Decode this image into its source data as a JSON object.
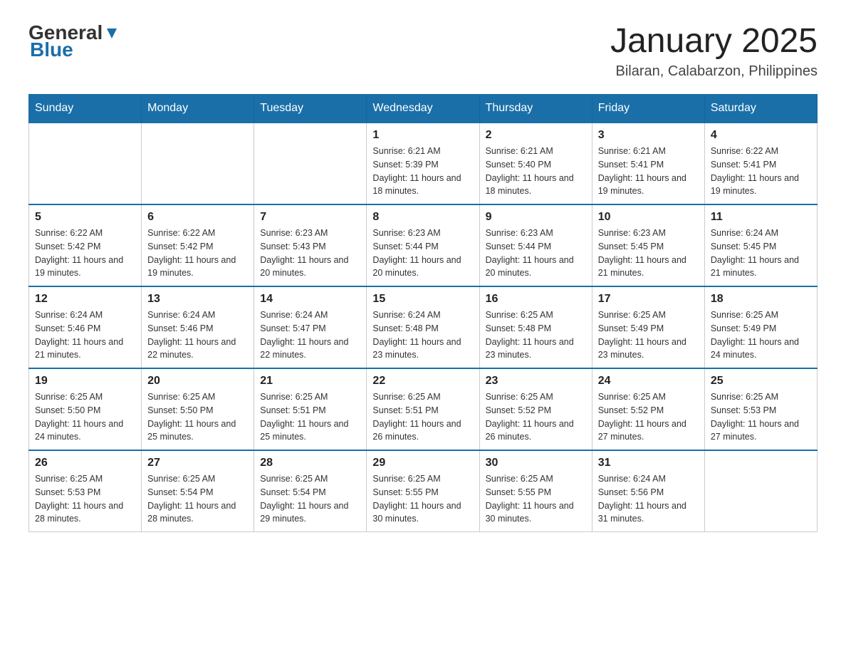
{
  "header": {
    "logo": {
      "general": "General",
      "blue": "Blue"
    },
    "title": "January 2025",
    "location": "Bilaran, Calabarzon, Philippines"
  },
  "days_of_week": [
    "Sunday",
    "Monday",
    "Tuesday",
    "Wednesday",
    "Thursday",
    "Friday",
    "Saturday"
  ],
  "weeks": [
    [
      {
        "day": "",
        "info": ""
      },
      {
        "day": "",
        "info": ""
      },
      {
        "day": "",
        "info": ""
      },
      {
        "day": "1",
        "info": "Sunrise: 6:21 AM\nSunset: 5:39 PM\nDaylight: 11 hours and 18 minutes."
      },
      {
        "day": "2",
        "info": "Sunrise: 6:21 AM\nSunset: 5:40 PM\nDaylight: 11 hours and 18 minutes."
      },
      {
        "day": "3",
        "info": "Sunrise: 6:21 AM\nSunset: 5:41 PM\nDaylight: 11 hours and 19 minutes."
      },
      {
        "day": "4",
        "info": "Sunrise: 6:22 AM\nSunset: 5:41 PM\nDaylight: 11 hours and 19 minutes."
      }
    ],
    [
      {
        "day": "5",
        "info": "Sunrise: 6:22 AM\nSunset: 5:42 PM\nDaylight: 11 hours and 19 minutes."
      },
      {
        "day": "6",
        "info": "Sunrise: 6:22 AM\nSunset: 5:42 PM\nDaylight: 11 hours and 19 minutes."
      },
      {
        "day": "7",
        "info": "Sunrise: 6:23 AM\nSunset: 5:43 PM\nDaylight: 11 hours and 20 minutes."
      },
      {
        "day": "8",
        "info": "Sunrise: 6:23 AM\nSunset: 5:44 PM\nDaylight: 11 hours and 20 minutes."
      },
      {
        "day": "9",
        "info": "Sunrise: 6:23 AM\nSunset: 5:44 PM\nDaylight: 11 hours and 20 minutes."
      },
      {
        "day": "10",
        "info": "Sunrise: 6:23 AM\nSunset: 5:45 PM\nDaylight: 11 hours and 21 minutes."
      },
      {
        "day": "11",
        "info": "Sunrise: 6:24 AM\nSunset: 5:45 PM\nDaylight: 11 hours and 21 minutes."
      }
    ],
    [
      {
        "day": "12",
        "info": "Sunrise: 6:24 AM\nSunset: 5:46 PM\nDaylight: 11 hours and 21 minutes."
      },
      {
        "day": "13",
        "info": "Sunrise: 6:24 AM\nSunset: 5:46 PM\nDaylight: 11 hours and 22 minutes."
      },
      {
        "day": "14",
        "info": "Sunrise: 6:24 AM\nSunset: 5:47 PM\nDaylight: 11 hours and 22 minutes."
      },
      {
        "day": "15",
        "info": "Sunrise: 6:24 AM\nSunset: 5:48 PM\nDaylight: 11 hours and 23 minutes."
      },
      {
        "day": "16",
        "info": "Sunrise: 6:25 AM\nSunset: 5:48 PM\nDaylight: 11 hours and 23 minutes."
      },
      {
        "day": "17",
        "info": "Sunrise: 6:25 AM\nSunset: 5:49 PM\nDaylight: 11 hours and 23 minutes."
      },
      {
        "day": "18",
        "info": "Sunrise: 6:25 AM\nSunset: 5:49 PM\nDaylight: 11 hours and 24 minutes."
      }
    ],
    [
      {
        "day": "19",
        "info": "Sunrise: 6:25 AM\nSunset: 5:50 PM\nDaylight: 11 hours and 24 minutes."
      },
      {
        "day": "20",
        "info": "Sunrise: 6:25 AM\nSunset: 5:50 PM\nDaylight: 11 hours and 25 minutes."
      },
      {
        "day": "21",
        "info": "Sunrise: 6:25 AM\nSunset: 5:51 PM\nDaylight: 11 hours and 25 minutes."
      },
      {
        "day": "22",
        "info": "Sunrise: 6:25 AM\nSunset: 5:51 PM\nDaylight: 11 hours and 26 minutes."
      },
      {
        "day": "23",
        "info": "Sunrise: 6:25 AM\nSunset: 5:52 PM\nDaylight: 11 hours and 26 minutes."
      },
      {
        "day": "24",
        "info": "Sunrise: 6:25 AM\nSunset: 5:52 PM\nDaylight: 11 hours and 27 minutes."
      },
      {
        "day": "25",
        "info": "Sunrise: 6:25 AM\nSunset: 5:53 PM\nDaylight: 11 hours and 27 minutes."
      }
    ],
    [
      {
        "day": "26",
        "info": "Sunrise: 6:25 AM\nSunset: 5:53 PM\nDaylight: 11 hours and 28 minutes."
      },
      {
        "day": "27",
        "info": "Sunrise: 6:25 AM\nSunset: 5:54 PM\nDaylight: 11 hours and 28 minutes."
      },
      {
        "day": "28",
        "info": "Sunrise: 6:25 AM\nSunset: 5:54 PM\nDaylight: 11 hours and 29 minutes."
      },
      {
        "day": "29",
        "info": "Sunrise: 6:25 AM\nSunset: 5:55 PM\nDaylight: 11 hours and 30 minutes."
      },
      {
        "day": "30",
        "info": "Sunrise: 6:25 AM\nSunset: 5:55 PM\nDaylight: 11 hours and 30 minutes."
      },
      {
        "day": "31",
        "info": "Sunrise: 6:24 AM\nSunset: 5:56 PM\nDaylight: 11 hours and 31 minutes."
      },
      {
        "day": "",
        "info": ""
      }
    ]
  ]
}
